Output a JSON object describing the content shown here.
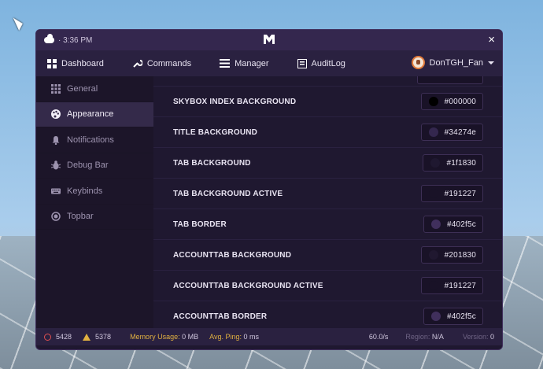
{
  "titlebar": {
    "time": "3:36 PM",
    "weather_icon": "cloud-icon",
    "close_label": "×"
  },
  "tabs": [
    {
      "label": "Dashboard",
      "icon": "grid-icon"
    },
    {
      "label": "Commands",
      "icon": "wrench-icon"
    },
    {
      "label": "Manager",
      "icon": "list-icon"
    },
    {
      "label": "AuditLog",
      "icon": "log-icon"
    }
  ],
  "account": {
    "username": "DonTGH_Fan"
  },
  "sidebar": {
    "items": [
      {
        "label": "General",
        "icon": "grid-dots-icon",
        "active": false
      },
      {
        "label": "Appearance",
        "icon": "palette-icon",
        "active": true
      },
      {
        "label": "Notifications",
        "icon": "bell-icon",
        "active": false
      },
      {
        "label": "Debug Bar",
        "icon": "bug-icon",
        "active": false
      },
      {
        "label": "Keybinds",
        "icon": "keyboard-icon",
        "active": false
      },
      {
        "label": "Topbar",
        "icon": "circle-icon",
        "active": false
      }
    ]
  },
  "settings": [
    {
      "label": "SKYBOX INDEX BACKGROUND",
      "value": "#000000",
      "color": "#000000"
    },
    {
      "label": "TITLE BACKGROUND",
      "value": "#34274e",
      "color": "#34274e"
    },
    {
      "label": "TAB BACKGROUND",
      "value": "#1f1830",
      "color": "#1f1830"
    },
    {
      "label": "TAB BACKGROUND ACTIVE",
      "value": "#191227",
      "color": "#191227"
    },
    {
      "label": "TAB BORDER",
      "value": "#402f5c",
      "color": "#402f5c"
    },
    {
      "label": "ACCOUNTTAB BACKGROUND",
      "value": "#201830",
      "color": "#201830"
    },
    {
      "label": "ACCOUNTTAB BACKGROUND ACTIVE",
      "value": "#191227",
      "color": "#191227"
    },
    {
      "label": "ACCOUNTTAB BORDER",
      "value": "#402f5c",
      "color": "#402f5c"
    }
  ],
  "statusbar": {
    "errors": "5428",
    "warnings": "5378",
    "memory_label": "Memory Usage:",
    "memory_value": "0 MB",
    "ping_label": "Avg. Ping:",
    "ping_value": "0 ms",
    "rate": "60.0/s",
    "region_label": "Region:",
    "region_value": "N/A",
    "version_label": "Version:",
    "version_value": "0"
  }
}
